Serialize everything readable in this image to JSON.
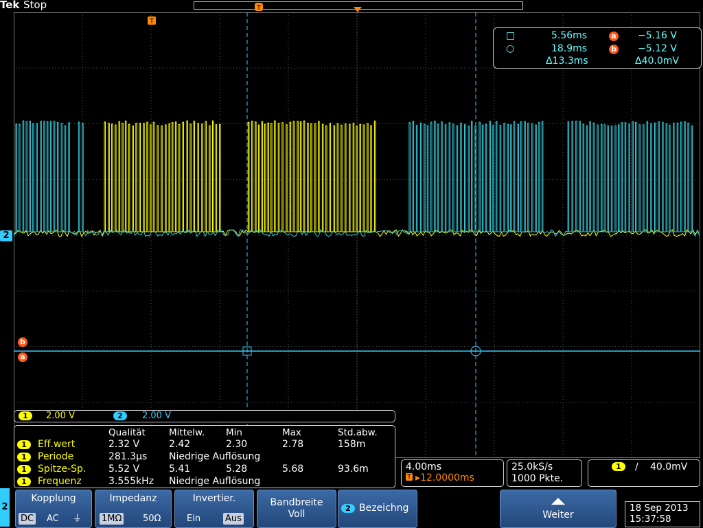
{
  "header": {
    "brand": "Tek",
    "run_state": "Stop"
  },
  "markers": {
    "trigger_top": "T",
    "cursor_a": "a",
    "cursor_b": "b",
    "ch2_level": "2"
  },
  "cursor_readout": {
    "c1_time": "5.56ms",
    "a_value": "−5.16 V",
    "c2_time": "18.9ms",
    "b_value": "−5.12 V",
    "delta_time": "Δ13.3ms",
    "delta_volt": "Δ40.0mV"
  },
  "channels": {
    "ch1": {
      "num": "1",
      "scale": "2.00 V"
    },
    "ch2": {
      "num": "2",
      "scale": "2.00 V"
    }
  },
  "measurements": {
    "headers": [
      "Qualität",
      "Mittelw.",
      "Min",
      "Max",
      "Std.abw."
    ],
    "rows": [
      {
        "ch": "1",
        "name": "Eff.wert",
        "q": "2.32 V",
        "mean": "2.42",
        "min": "2.30",
        "max": "2.78",
        "std": "158m"
      },
      {
        "ch": "1",
        "name": "Periode",
        "q": "281.3µs",
        "mean": "Niedrige Auflösung",
        "min": "",
        "max": "",
        "std": ""
      },
      {
        "ch": "1",
        "name": "Spitze-Sp.",
        "q": "5.52 V",
        "mean": "5.41",
        "min": "5.28",
        "max": "5.68",
        "std": "93.6m"
      },
      {
        "ch": "1",
        "name": "Frequenz",
        "q": "3.555kHz",
        "mean": "Niedrige Auflösung",
        "min": "",
        "max": "",
        "std": ""
      }
    ]
  },
  "timebase": {
    "scale": "4.00ms",
    "delay": "▸12.0000ms",
    "sample_rate": "25.0kS/s",
    "points": "1000 Pkte."
  },
  "trigger": {
    "source": "1",
    "slope_symbol": "∕",
    "level": "40.0mV"
  },
  "softkeys": {
    "side_channel": "2",
    "kopplung": {
      "title": "Kopplung",
      "opts": [
        "DC",
        "AC",
        "⏚"
      ]
    },
    "impedanz": {
      "title": "Impedanz",
      "opts": [
        "1MΩ",
        "50Ω"
      ]
    },
    "invertier": {
      "title": "Invertier.",
      "opts": [
        "Ein",
        "Aus"
      ]
    },
    "bandbreite": {
      "title": "Bandbreite",
      "value": "Voll"
    },
    "bezeichnung": {
      "chip": "2",
      "title": "Bezeichng"
    },
    "weiter": {
      "title": "Weiter"
    }
  },
  "datetime": {
    "date": "18 Sep  2013",
    "time": "15:37:58"
  },
  "colors": {
    "ch1": "#ffff00",
    "ch2": "#33ccdd",
    "grid": "#555555"
  },
  "chart_data": {
    "type": "line",
    "title": "",
    "xlabel": "",
    "ylabel": "",
    "note": "Oscilloscope traces: CH1 (yellow) pulse bursts in middle; CH2 (cyan) pulse bursts at left and right."
  }
}
